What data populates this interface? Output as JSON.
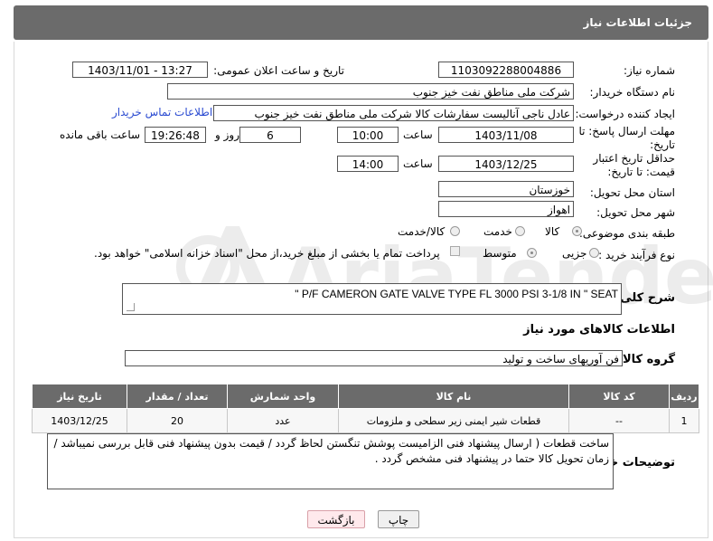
{
  "panel": {
    "title": "جزئیات اطلاعات نیاز"
  },
  "fields": {
    "need_number_label": "شماره نیاز:",
    "need_number": "1103092288004886",
    "announce_label": "تاریخ و ساعت اعلان عمومی:",
    "announce_value": "1403/11/01 - 13:27",
    "buyer_org_label": "نام دستگاه خریدار:",
    "buyer_org": "شرکت ملی مناطق نفت خیز جنوب",
    "creator_label": "ایجاد کننده درخواست:",
    "creator": "عادل  ناجی آنالیست سفارشات کالا  شرکت ملی مناطق نفت خیز جنوب",
    "buyer_contact_link": "اطلاعات تماس خریدار",
    "reply_deadline_label": "مهلت ارسال پاسخ: تا تاریخ:",
    "reply_date": "1403/11/08",
    "time_label": "ساعت",
    "reply_time": "10:00",
    "days_value": "6",
    "days_and_label": "روز و",
    "remaining_time": "19:26:48",
    "remaining_label": "ساعت باقی مانده",
    "price_validity_label": "حداقل تاریخ اعتبار قیمت: تا تاریخ:",
    "price_date": "1403/12/25",
    "price_time": "14:00",
    "province_label": "استان محل تحویل:",
    "province": "خوزستان",
    "city_label": "شهر محل تحویل:",
    "city": "اهواز",
    "category_label": "طبقه بندی موضوعی:",
    "category_options": [
      "کالا",
      "خدمت",
      "کالا/خدمت"
    ],
    "process_label": "نوع فرآیند خرید :",
    "process_options": [
      "جزیی",
      "متوسط"
    ],
    "payment_note": "پرداخت تمام یا بخشی از مبلغ خرید،از محل \"اسناد خزانه اسلامی\" خواهد بود."
  },
  "description": {
    "label": "شرح کلی نیاز:",
    "value": "\" P/F CAMERON GATE VALVE TYPE FL 3000 PSI 3-1/8 IN  \" SEAT"
  },
  "goods_info_title": "اطلاعات کالاهای مورد نیاز",
  "goods_group": {
    "label": "گروه کالا:",
    "value": "فن آوریهای ساخت و تولید"
  },
  "table": {
    "headers": [
      "ردیف",
      "کد کالا",
      "نام کالا",
      "واحد شمارش",
      "تعداد / مقدار",
      "تاریخ نیاز"
    ],
    "rows": [
      [
        "1",
        "--",
        "قطعات شیر ایمنی زیر سطحی و ملزومات",
        "عدد",
        "20",
        "1403/12/25"
      ]
    ]
  },
  "buyer_notes": {
    "label": "توضیحات خریدار:",
    "value": "ساخت قطعات ( ارسال پیشنهاد فنی الزامیست پوشش تنگستن لحاظ گردد / قیمت بدون پیشنهاد فنی قابل بررسی نمیباشد / زمان تحویل کالا حتما در پیشنهاد فنی مشخص گردد ."
  },
  "buttons": {
    "print": "چاپ",
    "back": "بازگشت"
  },
  "watermark_text": "AriaTender.net"
}
